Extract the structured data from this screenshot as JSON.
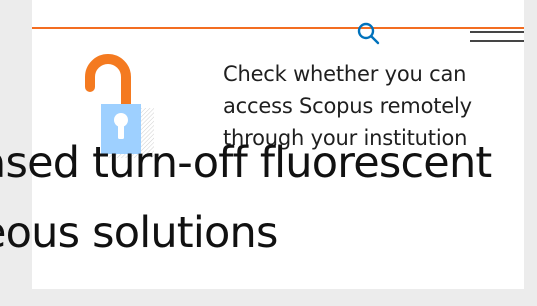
{
  "colors": {
    "page_background": "#ececec",
    "card_background": "#ffffff",
    "accent_orange": "#f36d21",
    "search_blue": "#0072bc",
    "lock_shackle": "#f47a20",
    "lock_body": "#9ed0ff",
    "lock_hatch": "#d0d0d0",
    "menu_dark": "#454545"
  },
  "header": {
    "search_icon": "search-icon",
    "menu_icon": "hamburger-menu-icon"
  },
  "access_banner": {
    "icon": "unlocked-padlock-icon",
    "text": "Check whether you can access Scopus remotely through your institution"
  },
  "background_title": {
    "line1": "ased turn-off fluorescent",
    "line2": "eous solutions"
  }
}
